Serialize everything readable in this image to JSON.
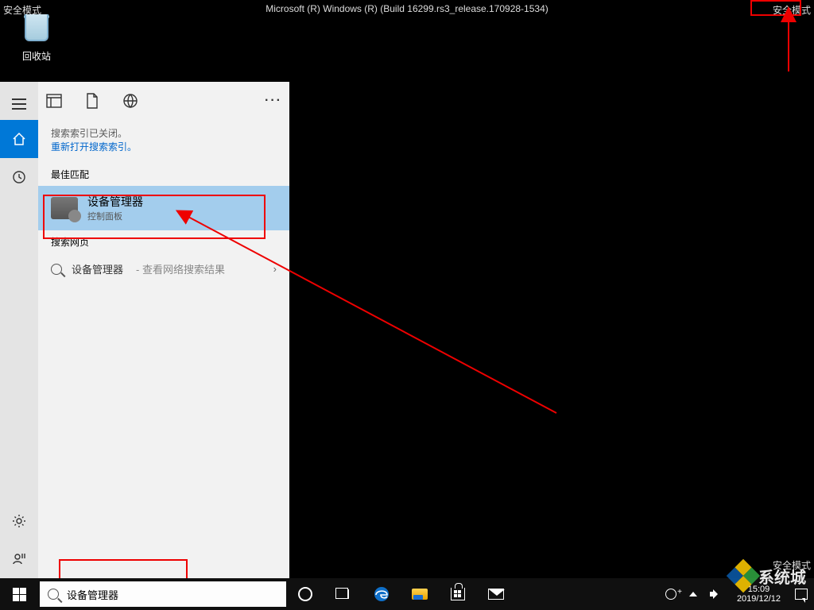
{
  "watermark": {
    "top_center": "Microsoft (R) Windows (R) (Build 16299.rs3_release.170928-1534)",
    "top_left": "安全模式",
    "top_right": "安全模式",
    "bottom_right": "安全模式",
    "logo_text": "系统城"
  },
  "desktop": {
    "recycle_bin": "回收站"
  },
  "search_panel": {
    "notice_line1": "搜索索引已关闭。",
    "notice_link": "重新打开搜索索引。",
    "section_best": "最佳匹配",
    "best_title": "设备管理器",
    "best_sub": "控制面板",
    "section_web": "搜索网页",
    "web_query": "设备管理器",
    "web_suffix": " - 查看网络搜索结果"
  },
  "taskbar": {
    "search_value": "设备管理器",
    "clock_time": "15:09",
    "clock_date": "2019/12/12"
  }
}
